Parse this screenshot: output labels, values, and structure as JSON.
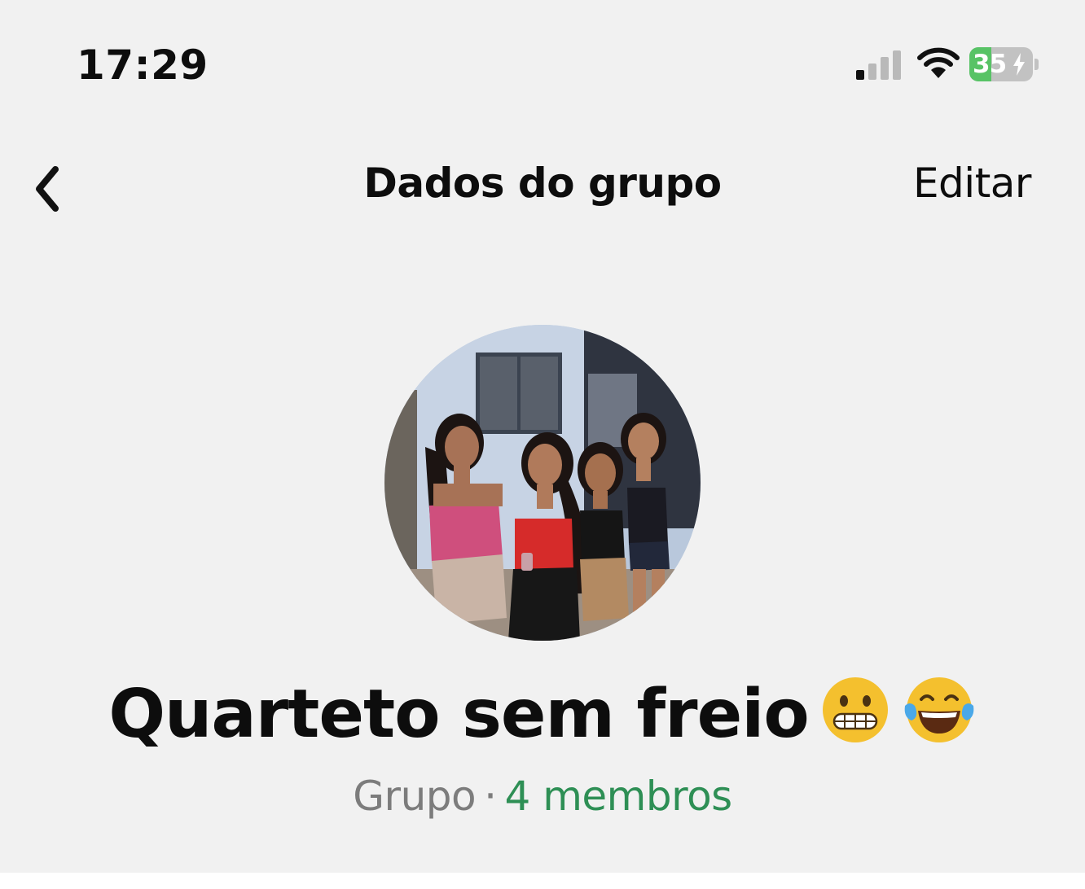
{
  "status_bar": {
    "time": "17:29",
    "battery_level": "35",
    "battery_fraction": 0.35,
    "battery_charging": true,
    "signal_icon": "cellular-signal-icon",
    "wifi_icon": "wifi-icon"
  },
  "nav": {
    "back_icon": "chevron-left-icon",
    "title": "Dados do grupo",
    "edit_label": "Editar"
  },
  "group": {
    "name": "Quarteto sem freio",
    "emojis": [
      "grimacing-face-emoji",
      "tears-of-joy-emoji"
    ],
    "kind": "Grupo",
    "separator": "·",
    "members": "4 membros"
  },
  "colors": {
    "background": "#f1f1f1",
    "members_link": "#2e8f55",
    "secondary_text": "#7c7c7c",
    "battery_fill": "#58c366"
  }
}
